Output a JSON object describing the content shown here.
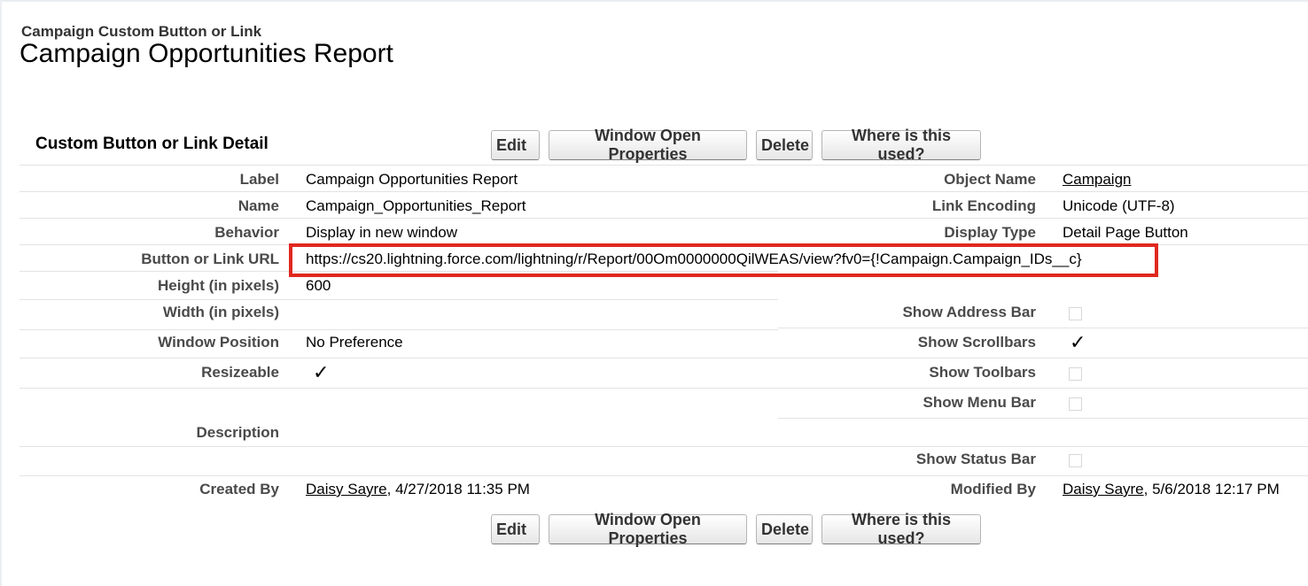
{
  "header": {
    "breadcrumb": "Campaign Custom Button or Link",
    "title": "Campaign Opportunities Report"
  },
  "section": {
    "title": "Custom Button or Link Detail"
  },
  "buttons": {
    "edit": "Edit",
    "window_open_properties": "Window Open Properties",
    "delete": "Delete",
    "where_used": "Where is this used?"
  },
  "fields": {
    "label": {
      "label": "Label",
      "value": "Campaign Opportunities Report"
    },
    "name": {
      "label": "Name",
      "value": "Campaign_Opportunities_Report"
    },
    "behavior": {
      "label": "Behavior",
      "value": "Display in new window"
    },
    "url": {
      "label": "Button or Link URL",
      "value": "https://cs20.lightning.force.com/lightning/r/Report/00Om0000000QilWEAS/view?fv0={!Campaign.Campaign_IDs__c}"
    },
    "height": {
      "label": "Height (in pixels)",
      "value": "600"
    },
    "width": {
      "label": "Width (in pixels)",
      "value": ""
    },
    "window_position": {
      "label": "Window Position",
      "value": "No Preference"
    },
    "resizeable": {
      "label": "Resizeable",
      "checked": true
    },
    "description": {
      "label": "Description",
      "value": ""
    },
    "created_by": {
      "label": "Created By",
      "user": "Daisy Sayre",
      "date": ", 4/27/2018 11:35 PM"
    },
    "object_name": {
      "label": "Object Name",
      "value": "Campaign"
    },
    "link_encoding": {
      "label": "Link Encoding",
      "value": "Unicode (UTF-8)"
    },
    "display_type": {
      "label": "Display Type",
      "value": "Detail Page Button"
    },
    "show_address_bar": {
      "label": "Show Address Bar",
      "checked": false
    },
    "show_scrollbars": {
      "label": "Show Scrollbars",
      "checked": true
    },
    "show_toolbars": {
      "label": "Show Toolbars",
      "checked": false
    },
    "show_menu_bar": {
      "label": "Show Menu Bar",
      "checked": false
    },
    "show_status_bar": {
      "label": "Show Status Bar",
      "checked": false
    },
    "modified_by": {
      "label": "Modified By",
      "user": "Daisy Sayre",
      "date": ", 5/6/2018 12:17 PM"
    }
  },
  "icons": {
    "checkmark": "checkmark-icon"
  },
  "colors": {
    "highlight": "#e0281e"
  }
}
